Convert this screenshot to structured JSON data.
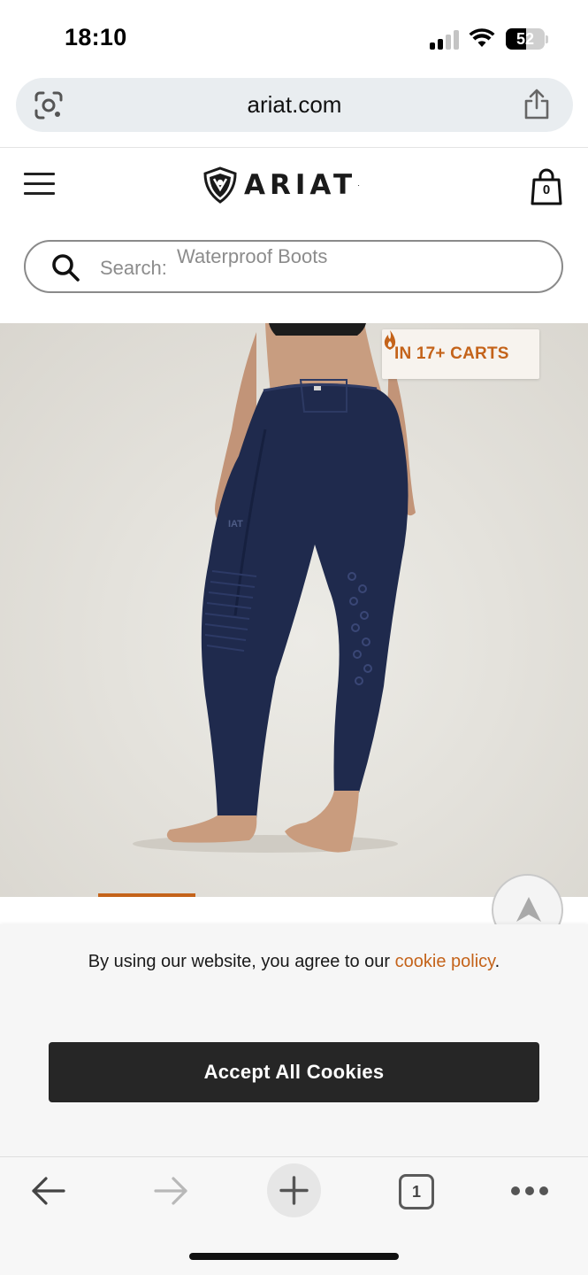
{
  "status_bar": {
    "time": "18:10",
    "battery_level": "52",
    "battery_fraction": 0.52,
    "signal_bars_active": 2,
    "icons": [
      "cellular-signal-icon",
      "wifi-icon",
      "battery-icon"
    ]
  },
  "browser": {
    "url": "ariat.com",
    "icons": {
      "lens": "google-lens-icon",
      "share": "share-icon"
    }
  },
  "header": {
    "logo_text": "ARIAT",
    "logo_tm": "·",
    "cart_count": "0",
    "icons": {
      "menu": "hamburger-menu-icon",
      "cart": "shopping-bag-icon",
      "logo": "ariat-shield-logo"
    }
  },
  "search": {
    "label": "Search:",
    "placeholder": "Waterproof Boots",
    "icon": "search-icon"
  },
  "product": {
    "badge_text": "IN 17+ CARTS",
    "badge_icon": "flame-icon",
    "image_subject": "navy-riding-tights-back-view",
    "legging_color": "#1f2a4d",
    "accent_color": "#c4631a"
  },
  "cookie_banner": {
    "text": "By using our website, you agree to our",
    "link_text": "cookie policy",
    "period": ".",
    "accept_label": "Accept All Cookies"
  },
  "bottom_nav": {
    "tab_count": "1",
    "icons": [
      "back-arrow-icon",
      "forward-arrow-icon",
      "plus-icon",
      "tabs-icon",
      "more-icon"
    ]
  }
}
